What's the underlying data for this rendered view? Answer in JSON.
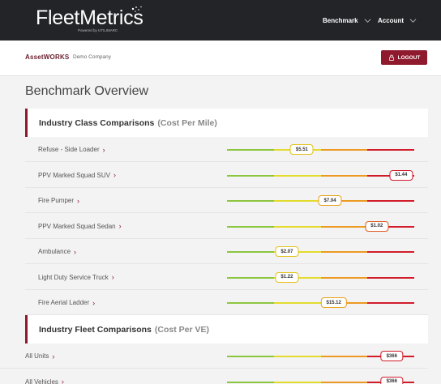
{
  "header": {
    "logo_text": "FleetMetrics",
    "logo_tagline": "Powered by UTILIMARC",
    "nav": [
      {
        "label": "Benchmark"
      },
      {
        "label": "Account"
      }
    ]
  },
  "subheader": {
    "brand": "AssetWORKS",
    "company": "Demo Company",
    "logout_label": "LOGOUT"
  },
  "page": {
    "title": "Benchmark Overview"
  },
  "class_section": {
    "title": "Industry Class Comparisons",
    "subtitle": "(Cost Per Mile)",
    "rows": [
      {
        "label": "Refuse - Side Loader",
        "value": "$5.51",
        "position": 0.4,
        "color": "#e3c21c"
      },
      {
        "label": "PPV Marked Squad SUV",
        "value": "$1.44",
        "position": 0.93,
        "color": "#d11d2a"
      },
      {
        "label": "Fire Pumper",
        "value": "$7.04",
        "position": 0.55,
        "color": "#e8a21a"
      },
      {
        "label": "PPV Marked Squad Sedan",
        "value": "$1.02",
        "position": 0.8,
        "color": "#e05a1e"
      },
      {
        "label": "Ambulance",
        "value": "$2.07",
        "position": 0.32,
        "color": "#e3c21c"
      },
      {
        "label": "Light Duty Service Truck",
        "value": "$1.22",
        "position": 0.32,
        "color": "#e3c21c"
      },
      {
        "label": "Fire Aerial Ladder",
        "value": "$15.12",
        "position": 0.57,
        "color": "#e8a21a"
      }
    ]
  },
  "fleet_section": {
    "title": "Industry Fleet Comparisons",
    "subtitle": "(Cost Per VE)",
    "rows": [
      {
        "label": "All Units",
        "value": "$366",
        "position": 0.88,
        "color": "#d11d2a"
      },
      {
        "label": "All Vehicles",
        "value": "$366",
        "position": 0.88,
        "color": "#d11d2a"
      }
    ]
  },
  "gauge_colors": [
    "#8cc63f",
    "#e3dc2c",
    "#ec9a23",
    "#d11d2a"
  ]
}
